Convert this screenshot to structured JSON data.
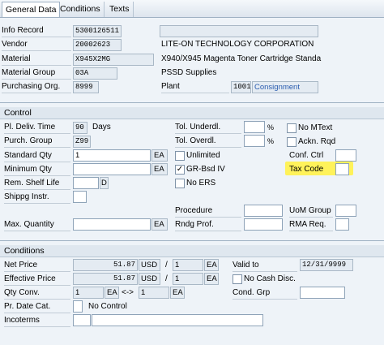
{
  "tabs": [
    "General Data",
    "Conditions",
    "Texts"
  ],
  "header": {
    "info_record_label": "Info Record",
    "info_record_value": "5300126511",
    "vendor_label": "Vendor",
    "vendor_value": "20002623",
    "vendor_name": "LITE-ON TECHNOLOGY CORPORATION",
    "material_label": "Material",
    "material_value": "X945X2MG",
    "material_desc": "X940/X945 Magenta Toner Cartridge Standa",
    "material_group_label": "Material Group",
    "material_group_value": "03A",
    "material_group_desc": "PSSD Supplies",
    "purch_org_label": "Purchasing Org.",
    "purch_org_value": "8999",
    "plant_label": "Plant",
    "plant_value": "1001",
    "plant_desc": "Consignment"
  },
  "control": {
    "title": "Control",
    "pl_deliv_time_label": "Pl. Deliv. Time",
    "pl_deliv_time_value": "90",
    "days_label": "Days",
    "purch_group_label": "Purch. Group",
    "purch_group_value": "Z99",
    "standard_qty_label": "Standard Qty",
    "standard_qty_value": "1",
    "standard_qty_unit": "EA",
    "minimum_qty_label": "Minimum Qty",
    "minimum_qty_unit": "EA",
    "rem_shelf_life_label": "Rem. Shelf Life",
    "rem_shelf_life_unit": "D",
    "shippg_instr_label": "Shippg Instr.",
    "max_quantity_label": "Max. Quantity",
    "max_quantity_unit": "EA",
    "tol_underdl_label": "Tol. Underdl.",
    "tol_overdl_label": "Tol. Overdl.",
    "percent": "%",
    "unlimited_label": "Unlimited",
    "gr_bsd_iv_label": "GR-Bsd IV",
    "gr_bsd_iv_check": "✓",
    "no_ers_label": "No ERS",
    "no_mtext_label": "No MText",
    "ackn_rqd_label": "Ackn. Rqd",
    "conf_ctrl_label": "Conf. Ctrl",
    "tax_code_label": "Tax Code",
    "procedure_label": "Procedure",
    "rndg_prof_label": "Rndg Prof.",
    "uom_group_label": "UoM Group",
    "rma_req_label": "RMA Req."
  },
  "conditions": {
    "title": "Conditions",
    "net_price_label": "Net Price",
    "net_price_value": "51.87",
    "net_price_currency": "USD",
    "net_price_per": "1",
    "net_price_unit": "EA",
    "effective_price_label": "Effective Price",
    "effective_price_value": "51.87",
    "effective_price_currency": "USD",
    "effective_price_per": "1",
    "effective_price_unit": "EA",
    "qty_conv_label": "Qty Conv.",
    "qty_conv_from": "1",
    "qty_conv_from_unit": "EA",
    "qty_conv_arrow": "<->",
    "qty_conv_to": "1",
    "qty_conv_to_unit": "EA",
    "valid_to_label": "Valid to",
    "valid_to_value": "12/31/9999",
    "no_cash_disc_label": "No Cash Disc.",
    "cond_grp_label": "Cond. Grp",
    "pr_date_cat_label": "Pr. Date Cat.",
    "pr_date_cat_desc": "No Control",
    "incoterms_label": "Incoterms",
    "slash": "/"
  },
  "colors": {
    "highlight": "#fff25a",
    "background": "#eef3f8",
    "link": "#2a5db0"
  }
}
